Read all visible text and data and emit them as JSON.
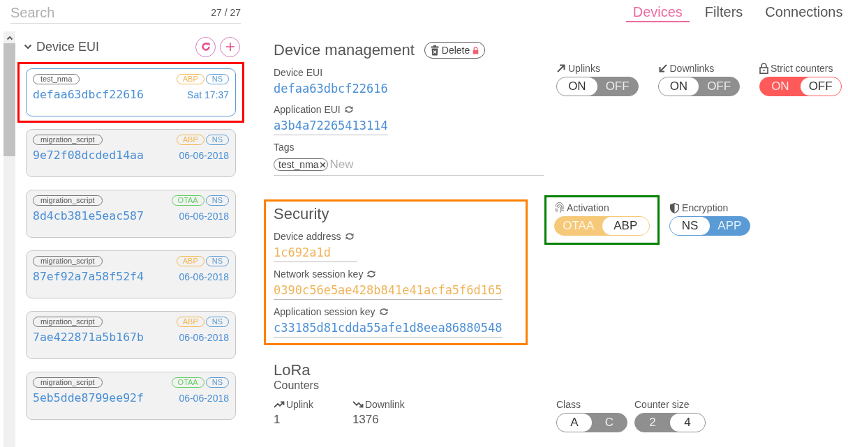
{
  "search": {
    "placeholder": "Search",
    "count": "27 / 27"
  },
  "tabs": [
    {
      "label": "Devices",
      "selected": true
    },
    {
      "label": "Filters",
      "selected": false
    },
    {
      "label": "Connections",
      "selected": false
    }
  ],
  "device_list": {
    "heading": "Device EUI",
    "expanded": true,
    "devices": [
      {
        "tag": "test_nma",
        "badges": [
          {
            "label": "ABP",
            "color": "#f5b652"
          },
          {
            "label": "NS",
            "color": "#5b9bd5"
          }
        ],
        "eui": "defaa63dbcf22616",
        "date": "Sat 17:37",
        "selected": true,
        "highlighted": true
      },
      {
        "tag": "migration_script",
        "badges": [
          {
            "label": "ABP",
            "color": "#f5b652"
          },
          {
            "label": "NS",
            "color": "#5b9bd5"
          }
        ],
        "eui": "9e72f08dcded14aa",
        "date": "06-06-2018",
        "selected": false
      },
      {
        "tag": "migration_script",
        "badges": [
          {
            "label": "OTAA",
            "color": "#5fcf5f"
          },
          {
            "label": "NS",
            "color": "#5b9bd5"
          }
        ],
        "eui": "8d4cb381e5eac587",
        "date": "06-06-2018",
        "selected": false
      },
      {
        "tag": "migration_script",
        "badges": [
          {
            "label": "ABP",
            "color": "#f5b652"
          },
          {
            "label": "NS",
            "color": "#5b9bd5"
          }
        ],
        "eui": "87ef92a7a58f52f4",
        "date": "06-06-2018",
        "selected": false
      },
      {
        "tag": "migration_script",
        "badges": [
          {
            "label": "ABP",
            "color": "#f5b652"
          },
          {
            "label": "NS",
            "color": "#5b9bd5"
          }
        ],
        "eui": "7ae422871a5b167b",
        "date": "06-06-2018",
        "selected": false
      },
      {
        "tag": "migration_script",
        "badges": [
          {
            "label": "OTAA",
            "color": "#5fcf5f"
          },
          {
            "label": "NS",
            "color": "#5b9bd5"
          }
        ],
        "eui": "5eb5dde8799ee92f",
        "date": "06-06-2018",
        "selected": false
      }
    ]
  },
  "device_management": {
    "title": "Device management",
    "delete_button": "Delete",
    "fields": [
      {
        "label": "Device EUI",
        "value": "defaa63dbcf22616",
        "regenerable": false,
        "editable": false,
        "color": "#4a8fd6"
      },
      {
        "label": "Application EUI",
        "value": "a3b4a72265413114",
        "regenerable": true,
        "editable": true,
        "color": "#4a8fd6"
      }
    ],
    "tags": {
      "label": "Tags",
      "items": [
        "test_nma"
      ],
      "placeholder": "New"
    },
    "switches": [
      {
        "label": "Uplinks",
        "color": "#8f8f8f",
        "options": [
          {
            "label": "ON",
            "selected": true
          },
          {
            "label": "OFF",
            "selected": false
          }
        ]
      },
      {
        "label": "Downlinks",
        "color": "#8f8f8f",
        "options": [
          {
            "label": "ON",
            "selected": true
          },
          {
            "label": "OFF",
            "selected": false
          }
        ]
      },
      {
        "label": "Strict counters",
        "color": "#ff5a5a",
        "options": [
          {
            "label": "ON",
            "selected": false
          },
          {
            "label": "OFF",
            "selected": true
          }
        ]
      }
    ]
  },
  "security": {
    "title": "Security",
    "highlighted": true,
    "fields": [
      {
        "label": "Device address",
        "value": "1c692a1d",
        "regenerable": true,
        "editable": true,
        "color": "#f0b45a"
      },
      {
        "label": "Network session key",
        "value": "0390c56e5ae428b841e41acfa5f6d165",
        "regenerable": true,
        "editable": true,
        "color": "#f0b45a"
      },
      {
        "label": "Application session key",
        "value": "c33185d81cdda55afe1d8eea86880548",
        "regenerable": true,
        "editable": true,
        "color": "#4a8fd6"
      }
    ],
    "switches": [
      {
        "label": "Activation",
        "color": "#f5c978",
        "highlighted": true,
        "options": [
          {
            "label": "OTAA",
            "selected": false
          },
          {
            "label": "ABP",
            "selected": true
          }
        ]
      },
      {
        "label": "Encryption",
        "color": "#5b9bd5",
        "options": [
          {
            "label": "NS",
            "selected": true
          },
          {
            "label": "APP",
            "selected": false
          }
        ]
      }
    ]
  },
  "lora": {
    "title": "LoRa",
    "subtitle": "Counters",
    "counters": [
      {
        "label": "Uplink",
        "value": "1"
      },
      {
        "label": "Downlink",
        "value": "1376"
      }
    ],
    "switches": [
      {
        "label": "Class",
        "color": "#8f8f8f",
        "options": [
          {
            "label": "A",
            "selected": true
          },
          {
            "label": "C",
            "selected": false
          }
        ]
      },
      {
        "label": "Counter size",
        "color": "#8f8f8f",
        "options": [
          {
            "label": "2",
            "selected": false
          },
          {
            "label": "4",
            "selected": true
          }
        ]
      }
    ]
  }
}
